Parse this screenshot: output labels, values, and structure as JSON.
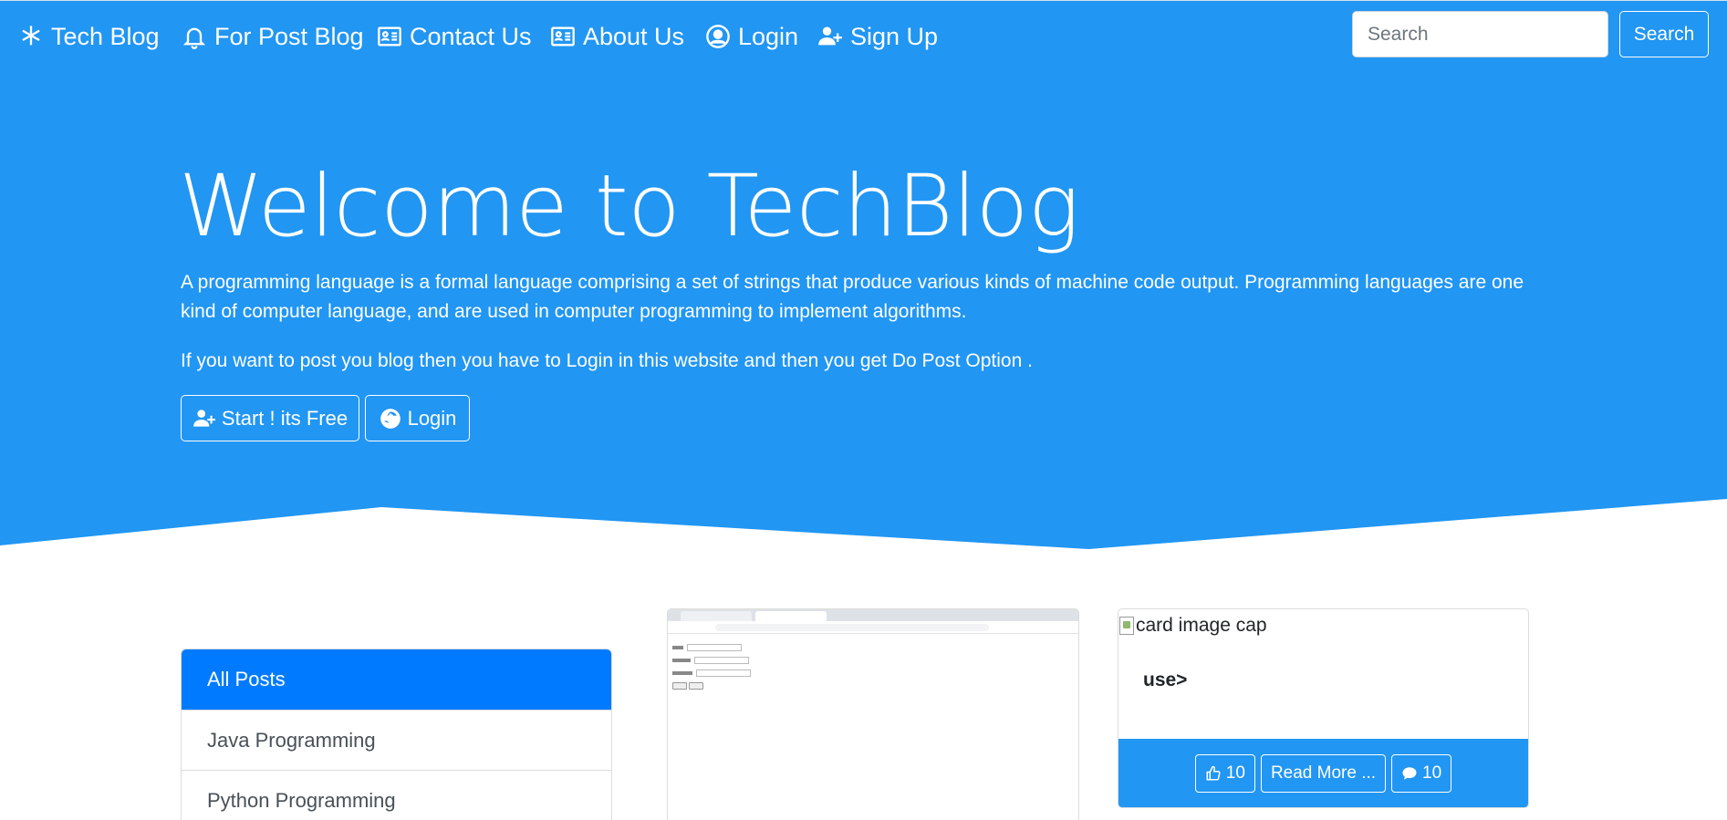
{
  "navbar": {
    "brand": "Tech Blog",
    "items": [
      {
        "label": "For Post Blog",
        "icon": "bell-icon"
      },
      {
        "label": "Contact Us",
        "icon": "address-card-icon"
      },
      {
        "label": "About Us",
        "icon": "address-card-icon"
      },
      {
        "label": "Login",
        "icon": "user-circle-icon"
      },
      {
        "label": "Sign Up",
        "icon": "user-plus-icon"
      }
    ],
    "brand_icon": "asterisk-icon",
    "search_placeholder": "Search",
    "search_button": "Search"
  },
  "hero": {
    "title": "Welcome to TechBlog",
    "lead": "A programming language is a formal language comprising a set of strings that produce various kinds of machine code output. Programming languages are one kind of computer language, and are used in computer programming to implement algorithms.",
    "lead2": "If you want to post you blog then you have to Login in this website and then you get Do Post Option .",
    "start_button": "Start ! its Free",
    "login_button": "Login"
  },
  "categories": {
    "items": [
      "All Posts",
      "Java Programming",
      "Python Programming"
    ],
    "active_index": 0
  },
  "posts": [
    {
      "image_alt": "card image cap",
      "title": "use>",
      "likes": "10",
      "read_more": "Read More ...",
      "comments": "10"
    }
  ],
  "colors": {
    "primary": "#2196f3",
    "active": "#007bff"
  }
}
